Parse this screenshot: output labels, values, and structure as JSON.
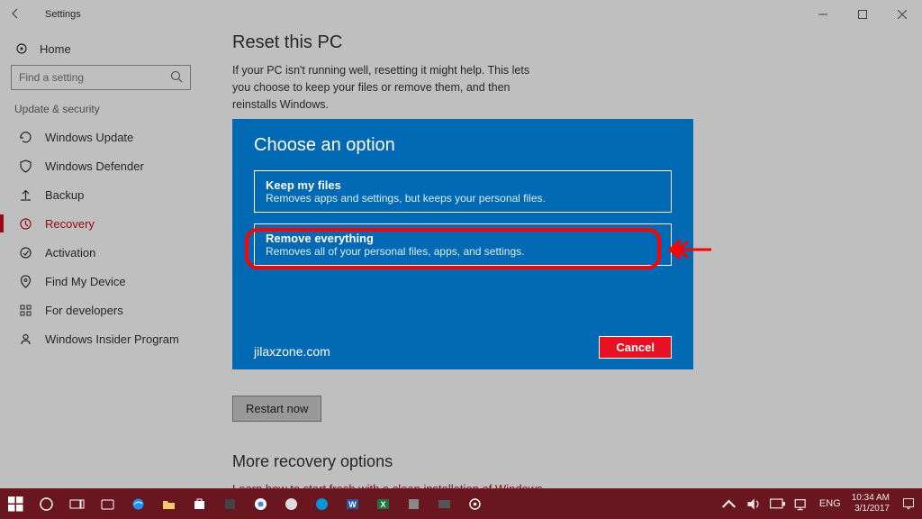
{
  "window": {
    "title": "Settings"
  },
  "sidebar": {
    "home": "Home",
    "search_placeholder": "Find a setting",
    "category": "Update & security",
    "items": [
      {
        "label": "Windows Update"
      },
      {
        "label": "Windows Defender"
      },
      {
        "label": "Backup"
      },
      {
        "label": "Recovery"
      },
      {
        "label": "Activation"
      },
      {
        "label": "Find My Device"
      },
      {
        "label": "For developers"
      },
      {
        "label": "Windows Insider Program"
      }
    ]
  },
  "main": {
    "title": "Reset this PC",
    "desc": "If your PC isn't running well, resetting it might help. This lets you choose to keep your files or remove them, and then reinstalls Windows.",
    "restart_btn": "Restart now",
    "more_title": "More recovery options",
    "more_link": "Learn how to start fresh with a clean installation of Windows"
  },
  "dialog": {
    "title": "Choose an option",
    "opt1_title": "Keep my files",
    "opt1_desc": "Removes apps and settings, but keeps your personal files.",
    "opt2_title": "Remove everything",
    "opt2_desc": "Removes all of your personal files, apps, and settings.",
    "branding": "jilaxzone.com",
    "cancel": "Cancel"
  },
  "taskbar": {
    "lang": "ENG",
    "time": "10:34 AM",
    "date": "3/1/2017"
  }
}
